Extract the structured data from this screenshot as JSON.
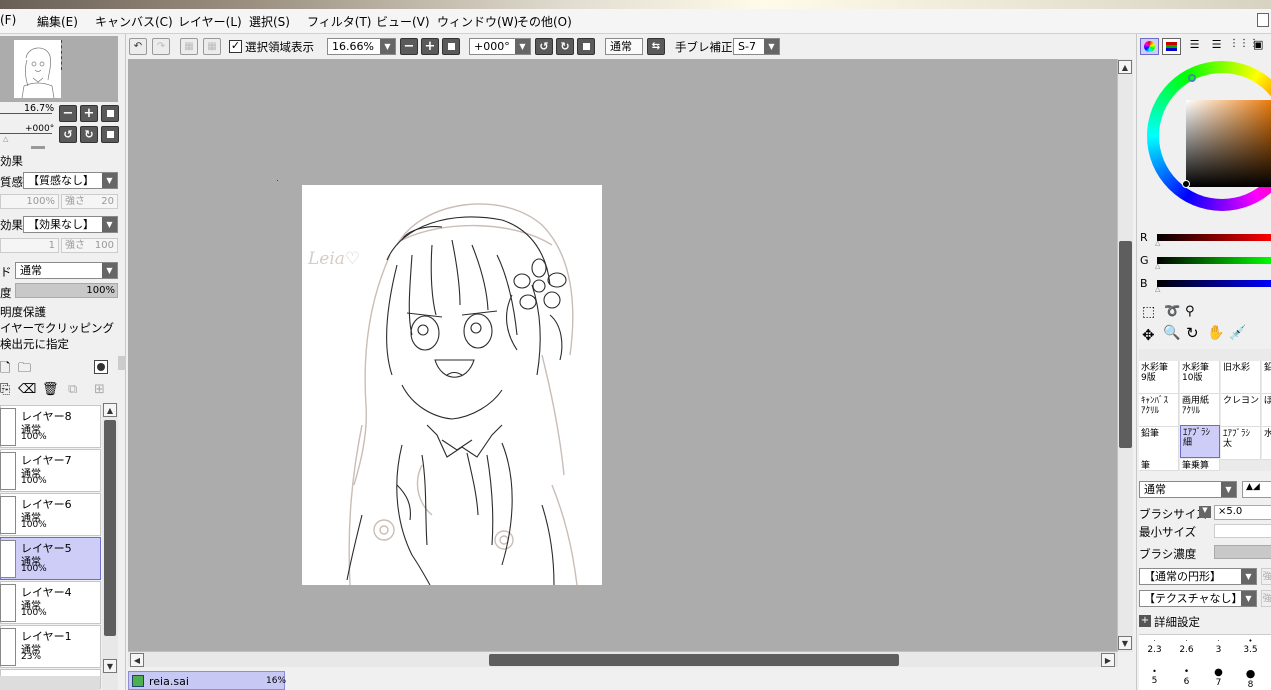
{
  "menu": {
    "file": "(F)",
    "edit": "編集(E)",
    "canvas": "キャンバス(C)",
    "layer": "レイヤー(L)",
    "select": "選択(S)",
    "filter": "フィルタ(T)",
    "view": "ビュー(V)",
    "window": "ウィンドウ(W)",
    "other": "その他(O)"
  },
  "toolbar": {
    "show_selection_label": "選択領域表示",
    "zoom_value": "16.66%",
    "rotation_value": "+000°",
    "blend_mode": "通常",
    "stabilizer_label": "手ブレ補正",
    "stabilizer_value": "S-7"
  },
  "navigator": {
    "zoom": "16.7%",
    "angle": "+000°"
  },
  "layer_props": {
    "effect_heading": "効果",
    "texture_label": "質感",
    "texture_value": "【質感なし】",
    "texture_scale": "100%",
    "texture_strength_label": "強さ",
    "texture_strength": "20",
    "effect_label": "効果",
    "effect_value": "【効果なし】",
    "effect_width": "1",
    "effect_strength_label": "強さ",
    "effect_strength": "100",
    "mode_label": "ド",
    "mode_value": "通常",
    "opacity_label": "度",
    "opacity_value": "100%",
    "preserve_opacity": "明度保護",
    "clipping": "イヤーでクリッピング",
    "selection_source": "検出元に指定"
  },
  "layers": [
    {
      "name": "レイヤー8",
      "mode": "通常",
      "opacity": "100%",
      "selected": false
    },
    {
      "name": "レイヤー7",
      "mode": "通常",
      "opacity": "100%",
      "selected": false
    },
    {
      "name": "レイヤー6",
      "mode": "通常",
      "opacity": "100%",
      "selected": false
    },
    {
      "name": "レイヤー5",
      "mode": "通常",
      "opacity": "100%",
      "selected": true
    },
    {
      "name": "レイヤー4",
      "mode": "通常",
      "opacity": "100%",
      "selected": false
    },
    {
      "name": "レイヤー1",
      "mode": "通常",
      "opacity": "23%",
      "selected": false
    }
  ],
  "document_tab": {
    "filename": "reia.sai",
    "zoom": "16%"
  },
  "canvas": {
    "signature": "Leia♡"
  },
  "color": {
    "r_label": "R",
    "g_label": "G",
    "b_label": "B"
  },
  "brushes": [
    {
      "name": "水彩筆",
      "sub": "9版",
      "selected": false
    },
    {
      "name": "水彩筆",
      "sub": "10版",
      "selected": false
    },
    {
      "name": "旧水彩",
      "sub": "",
      "selected": false
    },
    {
      "name": "鉛",
      "sub": "",
      "selected": false
    },
    {
      "name": "ｷｬﾝﾊﾞｽ",
      "sub": "ｱｸﾘﾙ",
      "selected": false
    },
    {
      "name": "画用紙",
      "sub": "ｱｸﾘﾙ",
      "selected": false
    },
    {
      "name": "クレヨン",
      "sub": "",
      "selected": false
    },
    {
      "name": "ぼ",
      "sub": "",
      "selected": false
    },
    {
      "name": "鉛筆",
      "sub": "",
      "selected": false
    },
    {
      "name": "ｴｱﾌﾞﾗｼ",
      "sub": "細",
      "selected": true
    },
    {
      "name": "ｴｱﾌﾞﾗｼ",
      "sub": "太",
      "selected": false
    },
    {
      "name": "水",
      "sub": "",
      "selected": false
    },
    {
      "name": "筆",
      "sub": "",
      "selected": false
    },
    {
      "name": "筆乗算",
      "sub": "",
      "selected": false
    }
  ],
  "brush_settings": {
    "blend_mode": "通常",
    "size_label": "ブラシサイズ",
    "size_multiplier": "×5.0",
    "min_size_label": "最小サイズ",
    "density_label": "ブラシ濃度",
    "shape_value": "【通常の円形】",
    "texture_value": "【テクスチャなし】",
    "advanced_label": "詳細設定",
    "strength_label_1": "強",
    "strength_label_2": "強"
  },
  "brush_sizes": [
    "2.3",
    "2.6",
    "3",
    "3.5",
    "5",
    "6",
    "7",
    "8"
  ]
}
